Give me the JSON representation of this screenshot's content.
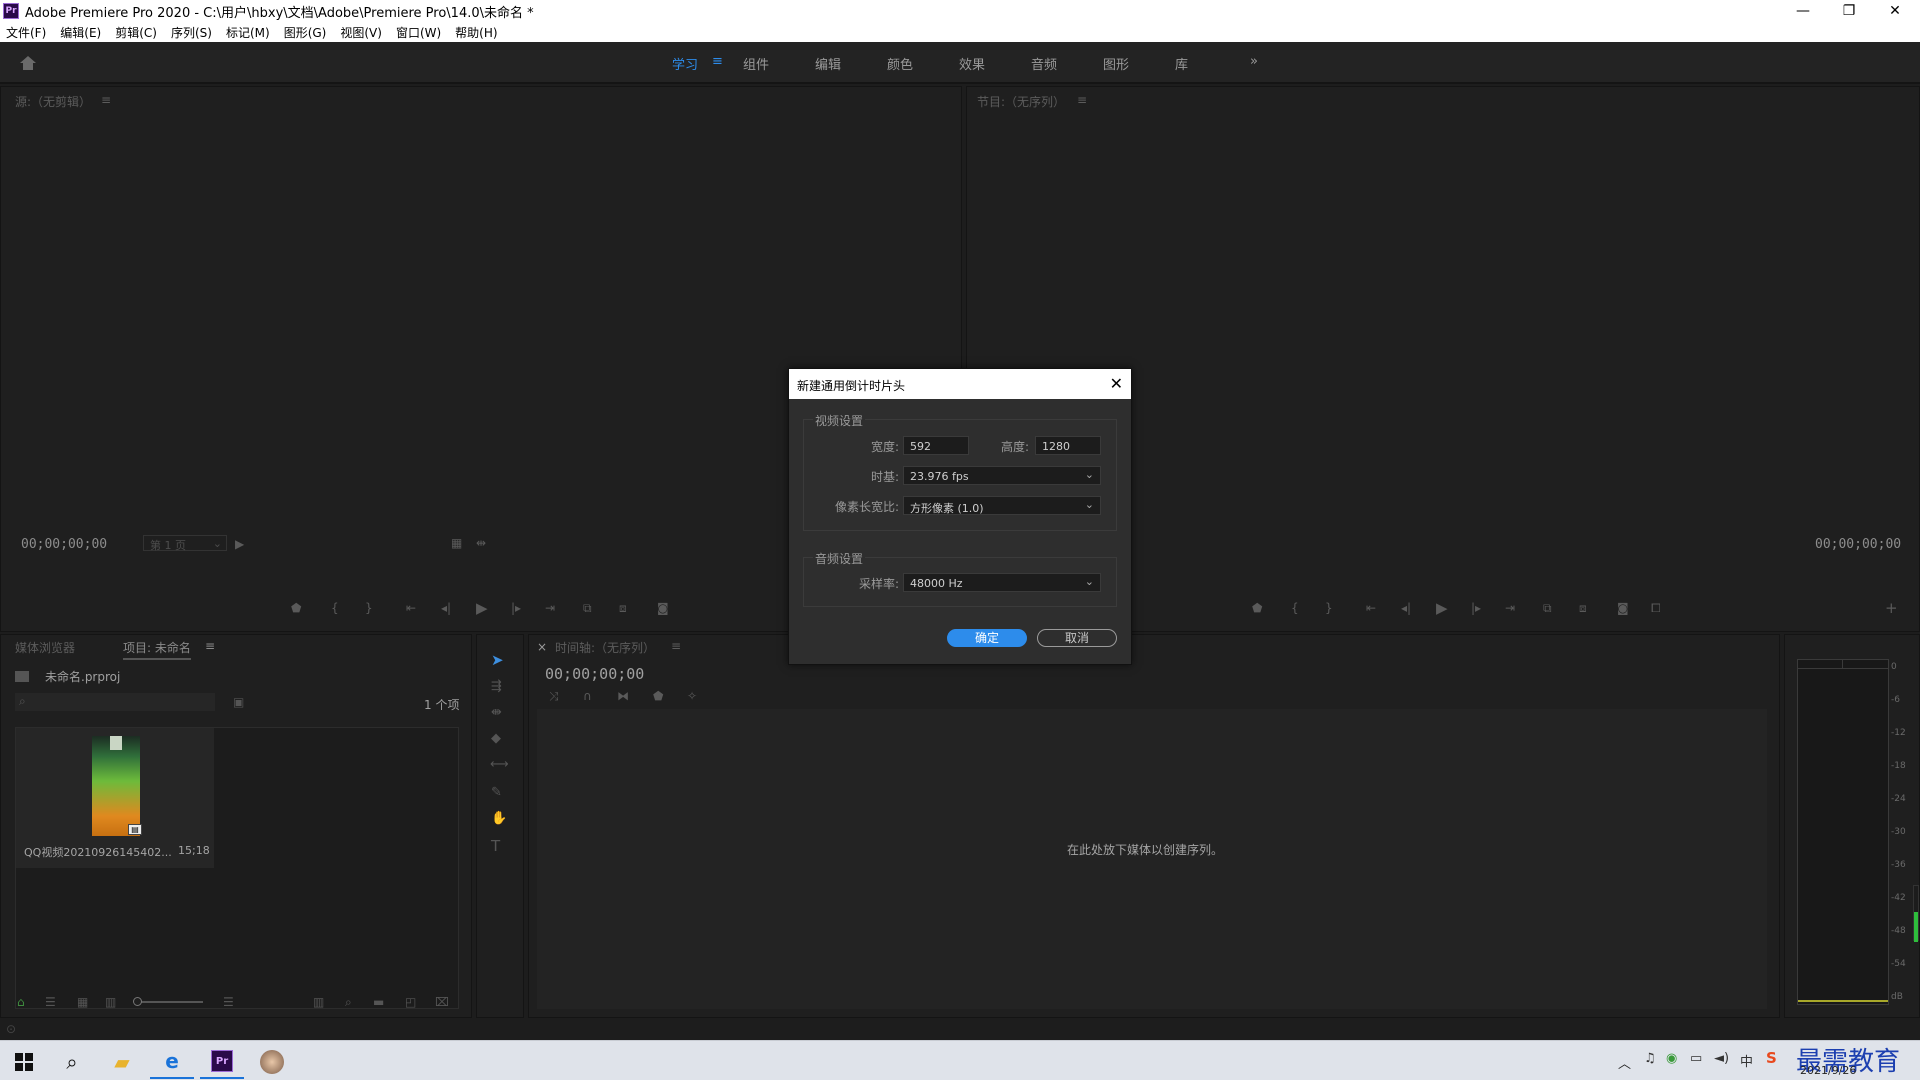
{
  "window": {
    "title": "Adobe Premiere Pro 2020 - C:\\用户\\hbxy\\文档\\Adobe\\Premiere Pro\\14.0\\未命名 *",
    "app_badge": "Pr"
  },
  "menu": [
    "文件(F)",
    "编辑(E)",
    "剪辑(C)",
    "序列(S)",
    "标记(M)",
    "图形(G)",
    "视图(V)",
    "窗口(W)",
    "帮助(H)"
  ],
  "workspaces": [
    "学习",
    "组件",
    "编辑",
    "颜色",
    "效果",
    "音频",
    "图形",
    "库"
  ],
  "source_monitor": {
    "title": "源:（无剪辑）",
    "timecode": "00;00;00;00",
    "page": "第 1 页"
  },
  "program_monitor": {
    "title": "节目:（无序列）",
    "timecode": "00;00;00;00"
  },
  "project_panel": {
    "tab_media": "媒体浏览器",
    "tab_project": "项目: 未命名",
    "project_file": "未命名.prproj",
    "item_count": "1 个项",
    "clip_name": "QQ视频20210926145402...",
    "clip_duration": "15;18"
  },
  "timeline": {
    "title": "时间轴:（无序列）",
    "timecode": "00;00;00;00",
    "empty_hint": "在此处放下媒体以创建序列。"
  },
  "audio_meter": {
    "scale": [
      "0",
      "-6",
      "-12",
      "-18",
      "-24",
      "-30",
      "-36",
      "-42",
      "-48",
      "-54",
      "dB"
    ]
  },
  "dialog": {
    "title": "新建通用倒计时片头",
    "video_section": "视频设置",
    "width_label": "宽度:",
    "width_value": "592",
    "height_label": "高度:",
    "height_value": "1280",
    "timebase_label": "时基:",
    "timebase_value": "23.976 fps",
    "par_label": "像素长宽比:",
    "par_value": "方形像素 (1.0)",
    "audio_section": "音频设置",
    "samplerate_label": "采样率:",
    "samplerate_value": "48000 Hz",
    "ok_label": "确定",
    "cancel_label": "取消"
  },
  "taskbar": {
    "date": "2021/9/26",
    "watermark": "最需教育",
    "ime": "中"
  },
  "colors": {
    "accent": "#2d8ceb",
    "panel": "#1f1f1f",
    "dialog": "#2e2e2e"
  }
}
